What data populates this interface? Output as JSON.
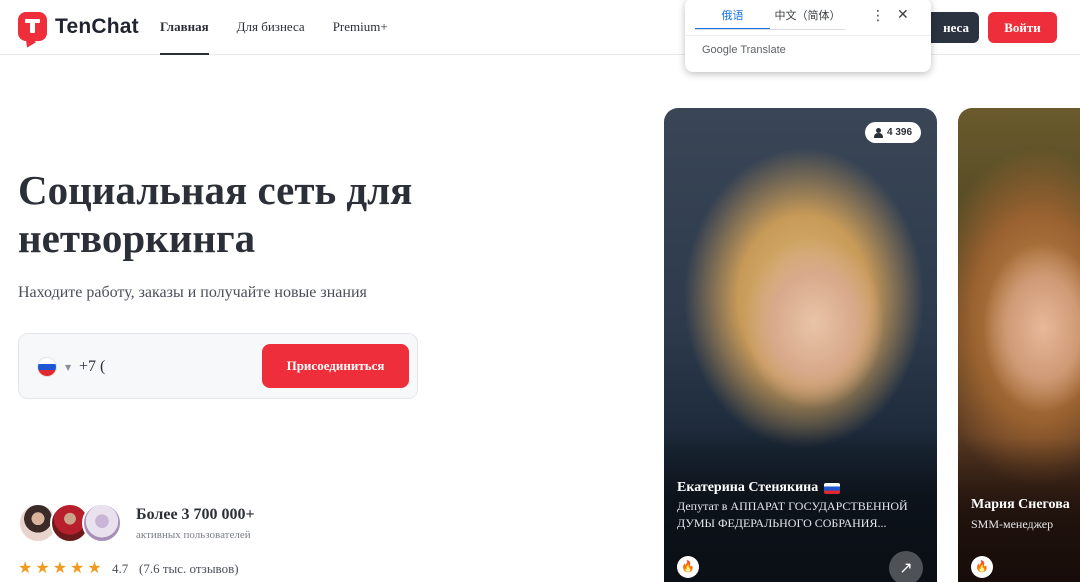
{
  "header": {
    "logo_text": "TenChat",
    "nav": [
      {
        "label": "Главная",
        "active": true
      },
      {
        "label": "Для бизнеса",
        "active": false
      },
      {
        "label": "Premium+",
        "active": false
      }
    ],
    "business_button": "неса",
    "login_button": "Войти"
  },
  "translate_popup": {
    "tabs": [
      "俄语",
      "中文（简体）"
    ],
    "active_tab": "俄语",
    "more_icon": "⋮",
    "close_icon": "✕",
    "brand": "Google Translate"
  },
  "hero": {
    "title": "Социальная сеть для нетворкинга",
    "subtitle": "Находите работу, заказы и получайте новые знания",
    "phone_prefix": "+7 (",
    "join_button": "Присоединиться"
  },
  "users": {
    "count": "Более 3 700 000+",
    "label": "активных пользователей",
    "stars": 5,
    "rating": "4.7",
    "reviews": "(7.6 тыс. отзывов)"
  },
  "cards": [
    {
      "followers": "4 396",
      "name": "Екатерина Стенякина",
      "has_flag": true,
      "description": "Депутат в АППАРАТ ГОСУДАРСТВЕННОЙ ДУМЫ ФЕДЕРАЛЬНОГО СОБРАНИЯ..."
    },
    {
      "name": "Мария Снегова",
      "description": "SMM-менеджер"
    }
  ],
  "colors": {
    "brand_red": "#ee2e3a",
    "dark": "#2b3240",
    "star": "#f29a1f",
    "google_blue": "#1a73e8"
  }
}
